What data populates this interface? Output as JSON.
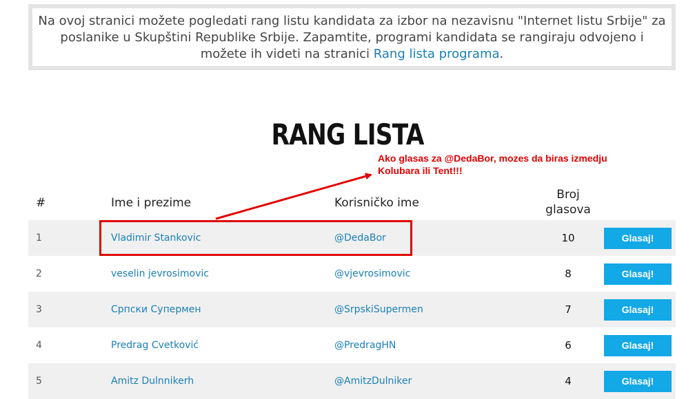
{
  "notice": {
    "text": "Na ovoj stranici možete pogledati rang listu kandidata za izbor na nezavisnu \"Internet listu Srbije\" za poslanike u Skupštini Republike Srbije. Zapamtite, programi kandidata se rangiraju odvojeno i možete ih videti na stranici ",
    "link": "Rang lista programa",
    "end": "."
  },
  "title": "RANG LISTA",
  "annotation": {
    "line1": "Ako glasas za @DedaBor, mozes da biras izmedju",
    "line2": "Kolubara ili Tent!!!",
    "color": "#e00000"
  },
  "table": {
    "headers": {
      "num": "#",
      "name": "Ime i prezime",
      "user": "Korisničko ime",
      "votes_line1": "Broj",
      "votes_line2": "glasova"
    },
    "vote_label": "Glasaj!",
    "rows": [
      {
        "num": "1",
        "name": "Vladimir Stankovic",
        "user": "@DedaBor",
        "votes": "10"
      },
      {
        "num": "2",
        "name": "veselin jevrosimovic",
        "user": "@vjevrosimovic",
        "votes": "8"
      },
      {
        "num": "3",
        "name": "Српски Супермен",
        "user": "@SrpskiSupermen",
        "votes": "7"
      },
      {
        "num": "4",
        "name": "Predrag Cvetković",
        "user": "@PredragHN",
        "votes": "6"
      },
      {
        "num": "5",
        "name": "Amitz Dulnnikerh",
        "user": "@AmitzDulniker",
        "votes": "4"
      }
    ]
  },
  "colors": {
    "link": "#1a7fb7",
    "button": "#13a8e6",
    "alt_row": "#f0f0f0"
  }
}
